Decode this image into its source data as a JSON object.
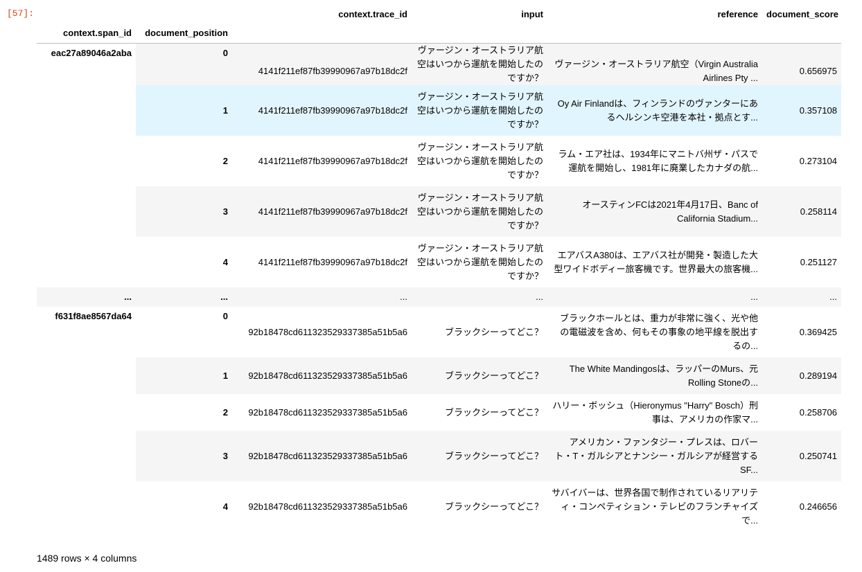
{
  "cell": {
    "prompt": "[57]:"
  },
  "columns": {
    "trace_id": "context.trace_id",
    "input": "input",
    "reference": "reference",
    "document_score": "document_score",
    "span_id": "context.span_id",
    "document_position": "document_position"
  },
  "groups": [
    {
      "span_id": "eac27a89046a2aba",
      "rows": [
        {
          "position": "0",
          "trace_id": "4141f211ef87fb39990967a97b18dc2f",
          "input": "ヴァージン・オーストラリア航空はいつから運航を開始したのですか？",
          "reference": "ヴァージン・オーストラリア航空（Virgin Australia Airlines Pty ...",
          "score": "0.656975"
        },
        {
          "position": "1",
          "trace_id": "4141f211ef87fb39990967a97b18dc2f",
          "input": "ヴァージン・オーストラリア航空はいつから運航を開始したのですか？",
          "reference": "Oy Air Finlandは、フィンランドのヴァンターにあるヘルシンキ空港を本社・拠点とす...",
          "score": "0.357108"
        },
        {
          "position": "2",
          "trace_id": "4141f211ef87fb39990967a97b18dc2f",
          "input": "ヴァージン・オーストラリア航空はいつから運航を開始したのですか？",
          "reference": "ラム・エア社は、1934年にマニトバ州ザ・パスで運航を開始し、1981年に廃業したカナダの航...",
          "score": "0.273104"
        },
        {
          "position": "3",
          "trace_id": "4141f211ef87fb39990967a97b18dc2f",
          "input": "ヴァージン・オーストラリア航空はいつから運航を開始したのですか？",
          "reference": "オースティンFCは2021年4月17日、Banc of California Stadium...",
          "score": "0.258114"
        },
        {
          "position": "4",
          "trace_id": "4141f211ef87fb39990967a97b18dc2f",
          "input": "ヴァージン・オーストラリア航空はいつから運航を開始したのですか？",
          "reference": "エアバスA380は、エアバス社が開発・製造した大型ワイドボディー旅客機です。世界最大の旅客機...",
          "score": "0.251127"
        }
      ]
    },
    {
      "span_id": "f631f8ae8567da64",
      "rows": [
        {
          "position": "0",
          "trace_id": "92b18478cd611323529337385a51b5a6",
          "input": "ブラックシーってどこ？",
          "reference": "ブラックホールとは、重力が非常に強く、光や他の電磁波を含め、何もその事象の地平線を脱出するの...",
          "score": "0.369425"
        },
        {
          "position": "1",
          "trace_id": "92b18478cd611323529337385a51b5a6",
          "input": "ブラックシーってどこ？",
          "reference": "The White Mandingosは、ラッパーのMurs、元Rolling Stoneの...",
          "score": "0.289194"
        },
        {
          "position": "2",
          "trace_id": "92b18478cd611323529337385a51b5a6",
          "input": "ブラックシーってどこ？",
          "reference": "ハリー・ボッシュ（Hieronymus \"Harry\" Bosch）刑事は、アメリカの作家マ...",
          "score": "0.258706"
        },
        {
          "position": "3",
          "trace_id": "92b18478cd611323529337385a51b5a6",
          "input": "ブラックシーってどこ？",
          "reference": "アメリカン・ファンタジー・プレスは、ロバート・T・ガルシアとナンシー・ガルシアが経営するSF...",
          "score": "0.250741"
        },
        {
          "position": "4",
          "trace_id": "92b18478cd611323529337385a51b5a6",
          "input": "ブラックシーってどこ？",
          "reference": "サバイバーは、世界各国で制作されているリアリティ・コンペティション・テレビのフランチャイズで...",
          "score": "0.246656"
        }
      ]
    }
  ],
  "ellipsis": "...",
  "footer": "1489 rows × 4 columns"
}
